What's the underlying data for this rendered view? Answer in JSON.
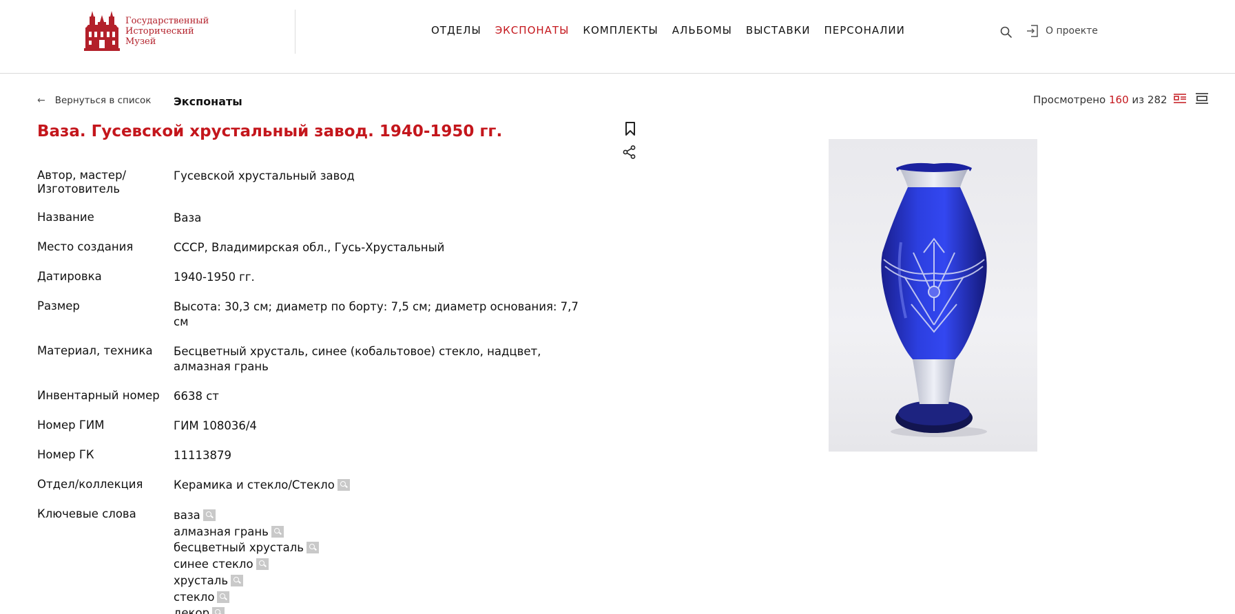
{
  "header": {
    "logo": {
      "line1": "Государственный",
      "line2": "Исторический",
      "line3": "Музей"
    },
    "nav": [
      {
        "label": "ОТДЕЛЫ",
        "active": false
      },
      {
        "label": "ЭКСПОНАТЫ",
        "active": true
      },
      {
        "label": "КОМПЛЕКТЫ",
        "active": false
      },
      {
        "label": "АЛЬБОМЫ",
        "active": false
      },
      {
        "label": "ВЫСТАВКИ",
        "active": false
      },
      {
        "label": "ПЕРСОНАЛИИ",
        "active": false
      }
    ],
    "search_icon": "search-icon",
    "about_label": "О проекте",
    "about_icon": "login-icon"
  },
  "subbar": {
    "back_label": "Вернуться в список",
    "section_title": "Экспонаты",
    "viewed_prefix": "Просмотрено",
    "viewed_current": "160",
    "viewed_sep": "из",
    "viewed_total": "282"
  },
  "item": {
    "title": "Ваза. Гусевской хрустальный завод. 1940-1950 гг.",
    "fields": [
      {
        "label": "Автор, мастер/ Изготовитель",
        "value": "Гусевской хрустальный завод"
      },
      {
        "label": "Название",
        "value": "Ваза"
      },
      {
        "label": "Место создания",
        "value": "СССР, Владимирская обл., Гусь-Хрустальный"
      },
      {
        "label": "Датировка",
        "value": "1940-1950 гг."
      },
      {
        "label": "Размер",
        "value": "Высота: 30,3 см; диаметр по борту: 7,5 см; диаметр основания: 7,7 см"
      },
      {
        "label": "Материал, техника",
        "value": "Бесцветный хрусталь, синее (кобальтовое) стекло, надцвет, алмазная грань"
      },
      {
        "label": "Инвентарный номер",
        "value": "6638 ст"
      },
      {
        "label": "Номер ГИМ",
        "value": "ГИМ 108036/4"
      },
      {
        "label": "Номер ГК",
        "value": "11113879"
      },
      {
        "label": "Отдел/коллекция",
        "value": "Керамика и стекло/Стекло"
      }
    ],
    "keywords_label": "Ключевые слова",
    "keywords": [
      "ваза",
      "алмазная грань",
      "бесцветный хрусталь",
      "синее стекло",
      "хрусталь",
      "стекло",
      "декор"
    ]
  },
  "colors": {
    "accent": "#c4161c",
    "text": "#111111",
    "search_tag": "#c9c9c9"
  }
}
